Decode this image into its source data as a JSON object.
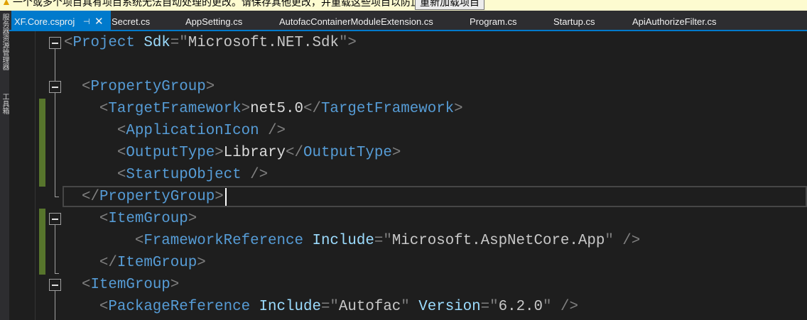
{
  "infobar": {
    "message": "一个或多个项目具有项目系统无法自动处理的更改。请保存其他更改，并重载这些项目以防止数据丢失。",
    "reload_button": "重新加载项目",
    "icon": "warning-icon"
  },
  "side_panels": [
    "服务器资源管理器",
    "工具箱"
  ],
  "tabs": [
    {
      "label": "XF.Core.csproj",
      "active": true
    },
    {
      "label": "Secret.cs"
    },
    {
      "label": "AppSetting.cs"
    },
    {
      "label": "AutofacContainerModuleExtension.cs"
    },
    {
      "label": "Program.cs"
    },
    {
      "label": "Startup.cs"
    },
    {
      "label": "ApiAuthorizeFilter.cs"
    }
  ],
  "tab_icons": {
    "pin": "⊣",
    "close": "✕"
  },
  "colors": {
    "accent": "#007acc",
    "tag": "#569cd6",
    "attribute": "#9cdcfe",
    "bracket": "#808080",
    "change_marker": "#57752c"
  },
  "editor": {
    "current_line": 8,
    "lines": [
      [
        [
          "b",
          "<"
        ],
        [
          "t",
          "Project"
        ],
        [
          "x",
          " "
        ],
        [
          "a",
          "Sdk"
        ],
        [
          "b",
          "=\""
        ],
        [
          "v",
          "Microsoft.NET.Sdk"
        ],
        [
          "b",
          "\">"
        ]
      ],
      [],
      [
        [
          "x",
          "  "
        ],
        [
          "b",
          "<"
        ],
        [
          "t",
          "PropertyGroup"
        ],
        [
          "b",
          ">"
        ]
      ],
      [
        [
          "x",
          "    "
        ],
        [
          "b",
          "<"
        ],
        [
          "t",
          "TargetFramework"
        ],
        [
          "b",
          ">"
        ],
        [
          "x",
          "net5.0"
        ],
        [
          "b",
          "</"
        ],
        [
          "t",
          "TargetFramework"
        ],
        [
          "b",
          ">"
        ]
      ],
      [
        [
          "x",
          "      "
        ],
        [
          "b",
          "<"
        ],
        [
          "t",
          "ApplicationIcon"
        ],
        [
          "x",
          " "
        ],
        [
          "b",
          "/>"
        ]
      ],
      [
        [
          "x",
          "      "
        ],
        [
          "b",
          "<"
        ],
        [
          "t",
          "OutputType"
        ],
        [
          "b",
          ">"
        ],
        [
          "x",
          "Library"
        ],
        [
          "b",
          "</"
        ],
        [
          "t",
          "OutputType"
        ],
        [
          "b",
          ">"
        ]
      ],
      [
        [
          "x",
          "      "
        ],
        [
          "b",
          "<"
        ],
        [
          "t",
          "StartupObject"
        ],
        [
          "x",
          " "
        ],
        [
          "b",
          "/>"
        ]
      ],
      [
        [
          "x",
          "  "
        ],
        [
          "b",
          "</"
        ],
        [
          "t",
          "PropertyGroup"
        ],
        [
          "b",
          ">"
        ]
      ],
      [
        [
          "x",
          "    "
        ],
        [
          "b",
          "<"
        ],
        [
          "t",
          "ItemGroup"
        ],
        [
          "b",
          ">"
        ]
      ],
      [
        [
          "x",
          "        "
        ],
        [
          "b",
          "<"
        ],
        [
          "t",
          "FrameworkReference"
        ],
        [
          "x",
          " "
        ],
        [
          "a",
          "Include"
        ],
        [
          "b",
          "=\""
        ],
        [
          "v",
          "Microsoft.AspNetCore.App"
        ],
        [
          "b",
          "\" />"
        ]
      ],
      [
        [
          "x",
          "    "
        ],
        [
          "b",
          "</"
        ],
        [
          "t",
          "ItemGroup"
        ],
        [
          "b",
          ">"
        ]
      ],
      [
        [
          "x",
          "  "
        ],
        [
          "b",
          "<"
        ],
        [
          "t",
          "ItemGroup"
        ],
        [
          "b",
          ">"
        ]
      ],
      [
        [
          "x",
          "    "
        ],
        [
          "b",
          "<"
        ],
        [
          "t",
          "PackageReference"
        ],
        [
          "x",
          " "
        ],
        [
          "a",
          "Include"
        ],
        [
          "b",
          "=\""
        ],
        [
          "v",
          "Autofac"
        ],
        [
          "b",
          "\" "
        ],
        [
          "a",
          "Version"
        ],
        [
          "b",
          "=\""
        ],
        [
          "v",
          "6.2.0"
        ],
        [
          "b",
          "\" />"
        ]
      ]
    ]
  }
}
